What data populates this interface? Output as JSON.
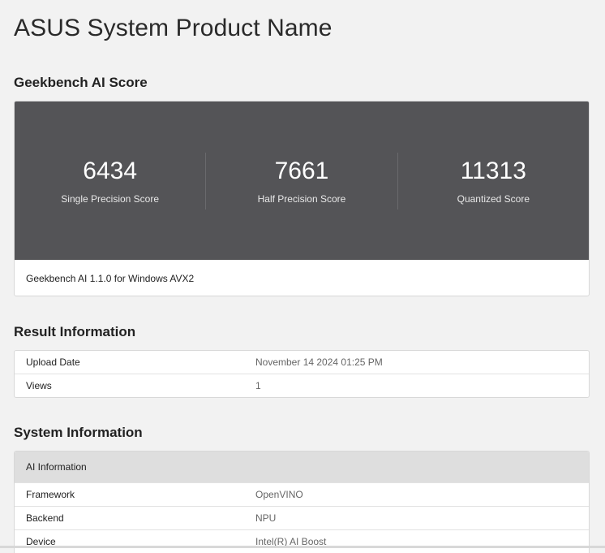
{
  "page": {
    "title": "ASUS System Product Name"
  },
  "score_section": {
    "heading": "Geekbench AI Score",
    "scores": [
      {
        "value": "6434",
        "label": "Single Precision Score"
      },
      {
        "value": "7661",
        "label": "Half Precision Score"
      },
      {
        "value": "11313",
        "label": "Quantized Score"
      }
    ],
    "footer": "Geekbench AI 1.1.0 for Windows AVX2"
  },
  "result_information": {
    "heading": "Result Information",
    "rows": [
      {
        "key": "Upload Date",
        "value": "November 14 2024 01:25 PM"
      },
      {
        "key": "Views",
        "value": "1"
      }
    ]
  },
  "system_information": {
    "heading": "System Information",
    "group_title": "AI Information",
    "rows": [
      {
        "key": "Framework",
        "value": "OpenVINO"
      },
      {
        "key": "Backend",
        "value": "NPU"
      },
      {
        "key": "Device",
        "value": "Intel(R) AI Boost"
      }
    ]
  }
}
